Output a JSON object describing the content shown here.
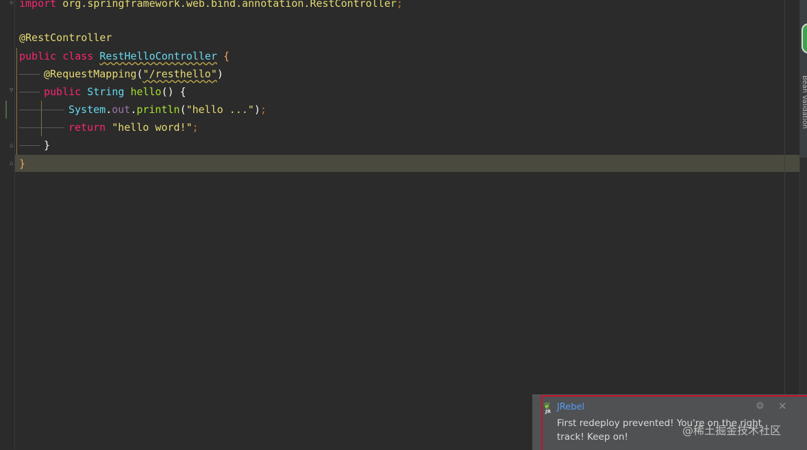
{
  "editor": {
    "lines": {
      "import_kw": "import",
      "import_path": " org.springframework.web.bind.annotation.RestController",
      "import_semi": ";",
      "class_annotation": "@RestController",
      "public1": "public",
      "class_kw": " class ",
      "class_name": "RestHelloController",
      "class_open": " {",
      "mapping_annotation": "@RequestMapping",
      "mapping_open": "(",
      "mapping_value": "\"/resthello\"",
      "mapping_close": ")",
      "public2": "public",
      "return_type": " String ",
      "method_name": "hello",
      "method_sig_end": "() {",
      "sys": "System",
      "dot1": ".",
      "out": "out",
      "dot2": ".",
      "println": "println",
      "println_open": "(",
      "println_str": "\"hello ...\"",
      "println_close": ")",
      "println_semi": ";",
      "return_kw": "return",
      "return_str": " \"hello word!\"",
      "return_semi": ";",
      "method_close": "}",
      "class_close": "}"
    }
  },
  "side_panel": {
    "label": "Bean Validation"
  },
  "notification": {
    "logo_text": "JR",
    "title": "JRebel",
    "message": "First redeploy prevented! You're on the right track! Keep on!"
  },
  "watermark": {
    "text": "@稀土掘金技术社区"
  },
  "colors": {
    "background": "#2b2b2b",
    "keyword": "#f92672",
    "annotation": "#e6db74",
    "type": "#66d9ef",
    "function": "#a6e22e",
    "string": "#e6db74",
    "highlight_frame": "#c8102e",
    "notification_title": "#589df6"
  },
  "icons": {
    "fold": "fold-icon",
    "settings": "gear-icon",
    "close": "close-icon",
    "jrebel": "jrebel-logo-icon"
  }
}
